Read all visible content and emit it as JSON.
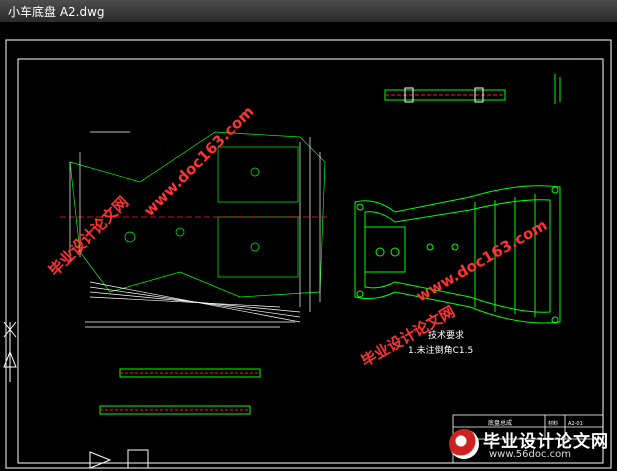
{
  "window": {
    "title": "小车底盘 A2.dwg"
  },
  "drawing": {
    "tech_req_title": "技术要求",
    "tech_req_item": "1.未注倒角C1.5",
    "title_block_name": "底盘总成",
    "title_block_label2": "材料",
    "title_block_label3": "比例",
    "title_block_code": "A2-01"
  },
  "watermarks": [
    {
      "text": "www.doc163.com"
    },
    {
      "text": "毕业设计论文网"
    }
  ],
  "brand": {
    "name": "毕业设计论文网",
    "url": "www.56doc.com"
  },
  "colors": {
    "line": "#00ff00",
    "white": "#ffffff",
    "red": "#ff2020",
    "yellow": "#ffff00",
    "watermark": "#ff3333"
  }
}
